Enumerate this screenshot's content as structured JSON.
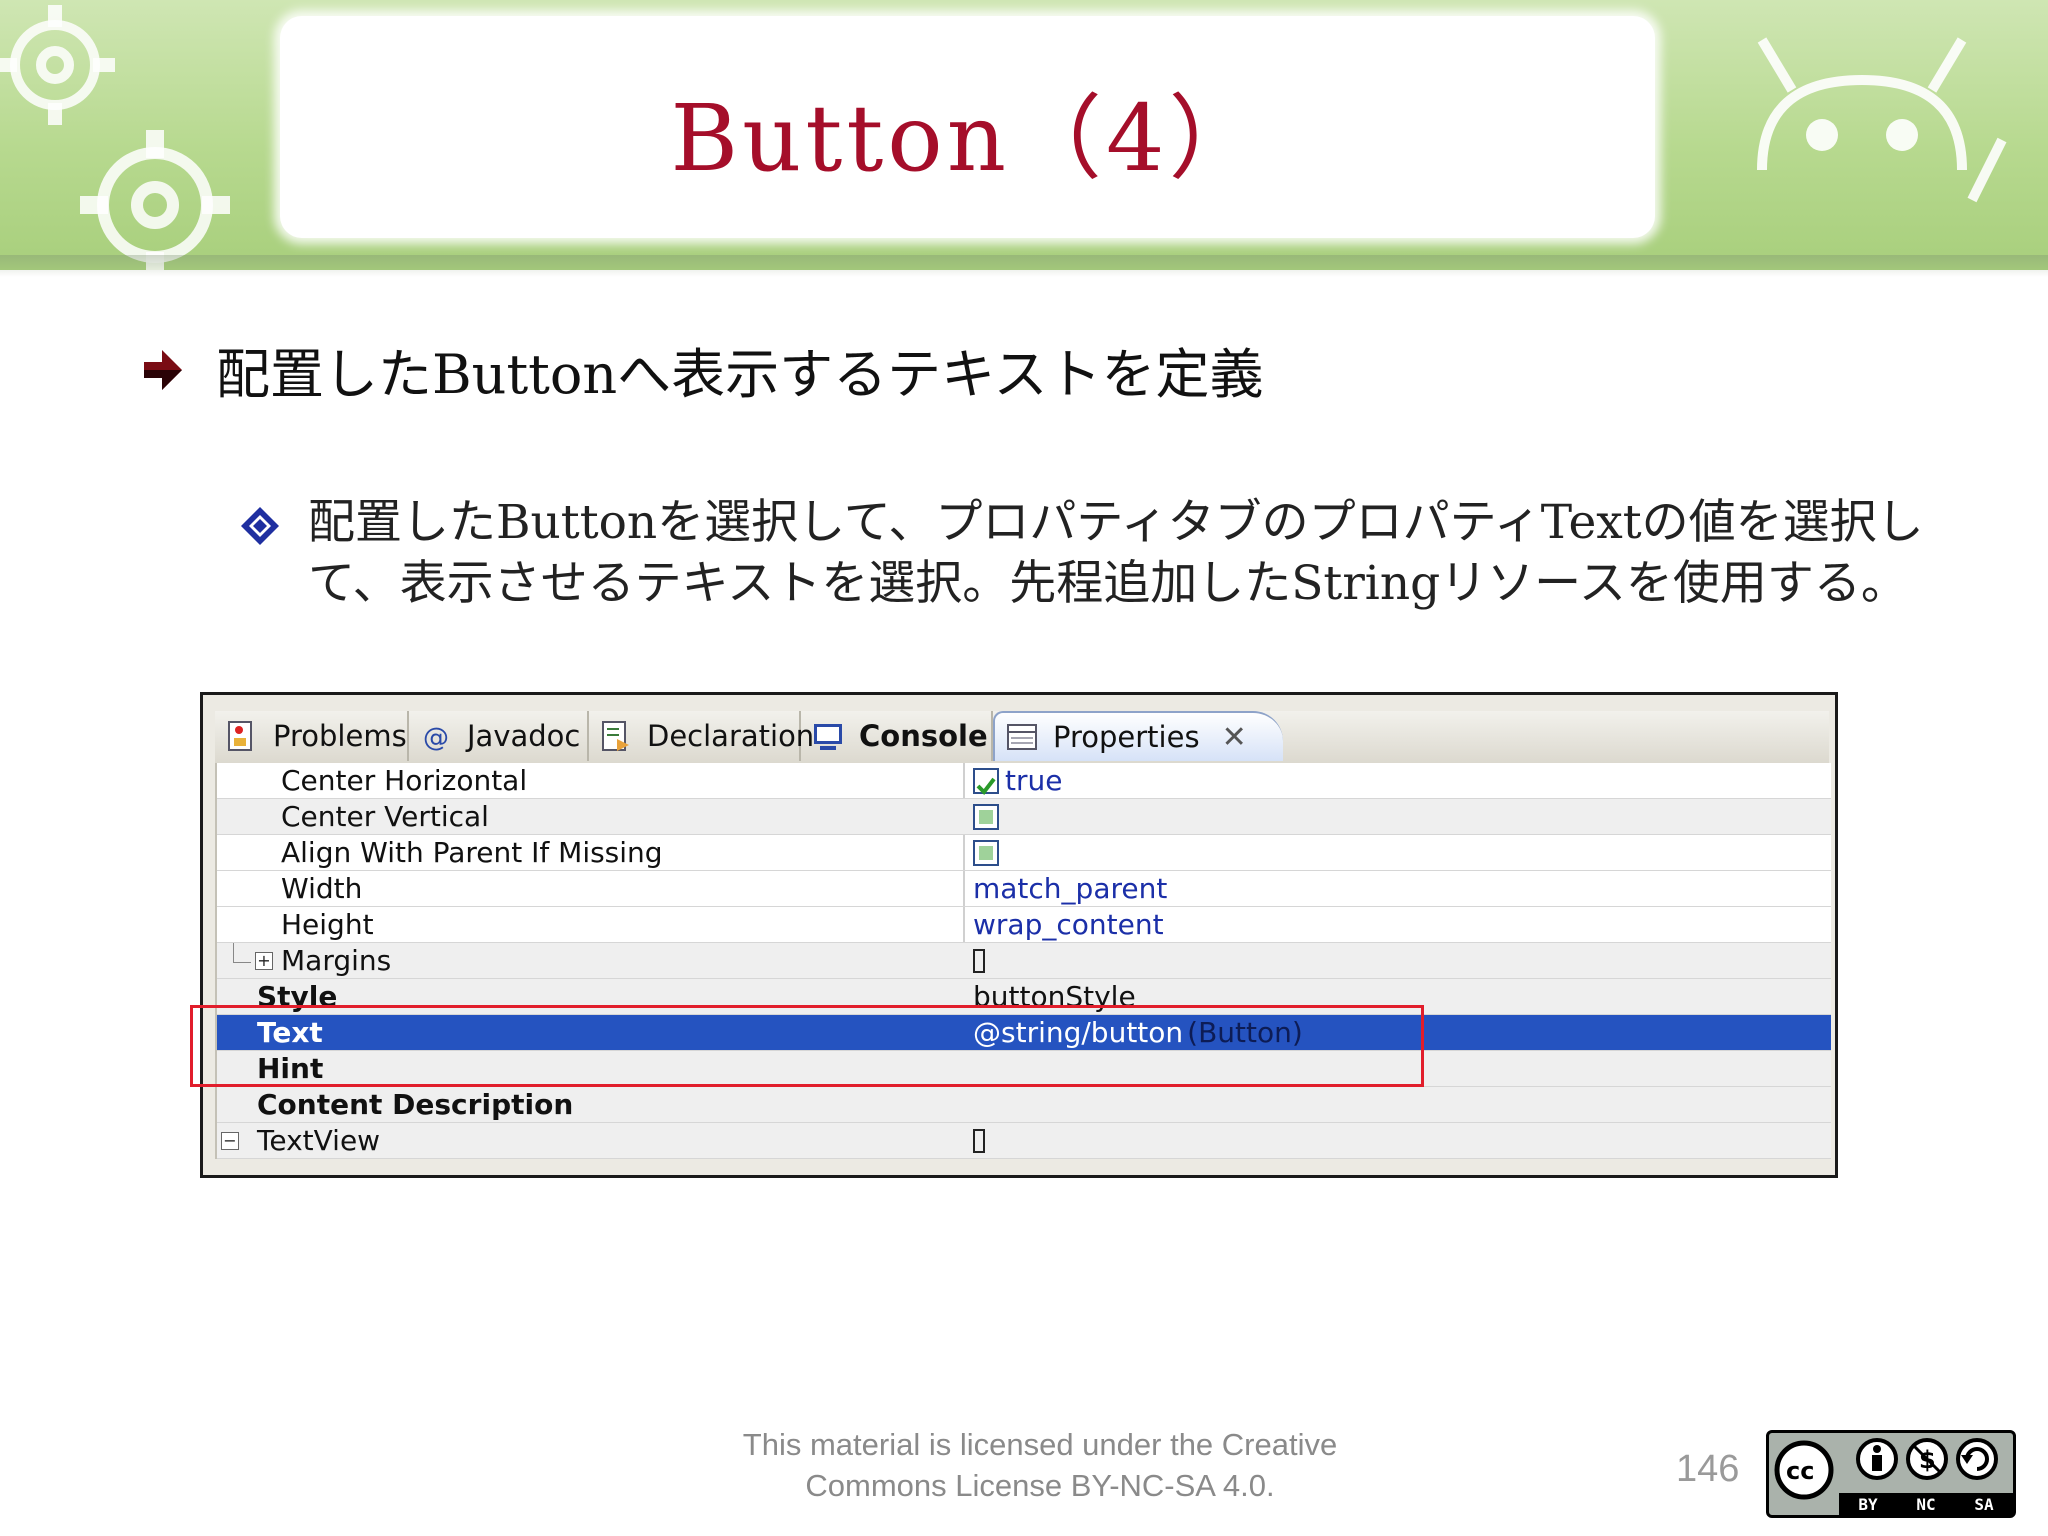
{
  "slide": {
    "title": "Button（4）",
    "bullet1": "配置したButtonへ表示するテキストを定義",
    "bullet2": "配置したButtonを選択して、プロパティタブのプロパティTextの値を選択して、表示させるテキストを選択。先程追加したStringリソースを使用する。"
  },
  "tabs": [
    {
      "label": "Problems",
      "icon": "problems-icon"
    },
    {
      "label": "Javadoc",
      "icon": "at-sign-icon"
    },
    {
      "label": "Declaration",
      "icon": "declaration-icon"
    },
    {
      "label": "Console",
      "icon": "console-icon"
    },
    {
      "label": "Properties",
      "icon": "properties-icon"
    }
  ],
  "properties": {
    "rows": [
      {
        "name": "Center Horizontal",
        "value": "true"
      },
      {
        "name": "Center Vertical",
        "value": ""
      },
      {
        "name": "Align With Parent If Missing",
        "value": ""
      },
      {
        "name": "Width",
        "value": "match_parent"
      },
      {
        "name": "Height",
        "value": "wrap_content"
      },
      {
        "name": "Margins",
        "value": ""
      },
      {
        "name": "Style",
        "value": "buttonStyle"
      },
      {
        "name": "Text",
        "value": "@string/button",
        "hint": "(Button)"
      },
      {
        "name": "Hint",
        "value": ""
      },
      {
        "name": "Content Description",
        "value": ""
      },
      {
        "name": "TextView",
        "value": ""
      }
    ]
  },
  "footer": {
    "license_line1": "This material is licensed under the Creative",
    "license_line2": "Commons License BY-NC-SA 4.0.",
    "page_number": "146",
    "cc_labels": [
      "BY",
      "NC",
      "SA"
    ]
  },
  "colors": {
    "title": "#a50e2a",
    "banner": "#b7d98f",
    "selection": "#2553c0",
    "highlight_box": "#e11d2b"
  }
}
